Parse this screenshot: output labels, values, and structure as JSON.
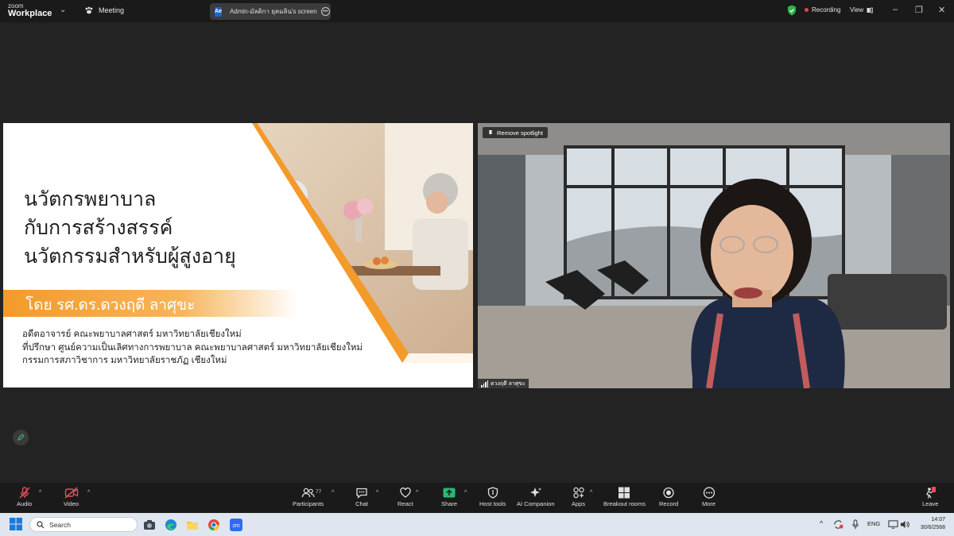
{
  "app": {
    "logo_top": "zoom",
    "logo_bottom": "Workplace",
    "meeting_label": "Meeting"
  },
  "tab": {
    "badge": "Ae",
    "title": "Admin-มัลติกา ยุคมลิน's screen"
  },
  "status": {
    "recording": "Recording",
    "view": "View"
  },
  "slide": {
    "title_lines": [
      "นวัตกรพยาบาล",
      "กับการสร้างสรรค์",
      "นวัตกรรมสำหรับผู้สูงอายุ"
    ],
    "byline": "โดย รศ.ดร.ดวงฤดี ลาศุขะ",
    "sub_lines": [
      "อดีตอาจารย์ คณะพยาบาลศาสตร์ มหาวิทยาลัยเชียงใหม่",
      "ที่ปรึกษา ศูนย์ความเป็นเลิศทางการพยาบาล คณะพยาบาลศาสตร์ มหาวิทยาลัยเชียงใหม่",
      "กรรมการสภาวิชาการ มหาวิทยาลัยราชภัฏ เชียงใหม่"
    ]
  },
  "video": {
    "spotlight_label": "Remove spotlight",
    "participant_name": "ดวงฤดี ลาศุขะ"
  },
  "toolbar": {
    "audio": "Audio",
    "video": "Video",
    "participants": "Participants",
    "participant_count": "77",
    "chat": "Chat",
    "react": "React",
    "share": "Share",
    "host_tools": "Host tools",
    "ai_companion": "AI Companion",
    "apps": "Apps",
    "breakout": "Breakout rooms",
    "record": "Record",
    "more": "More",
    "leave": "Leave"
  },
  "taskbar": {
    "search_placeholder": "Search",
    "lang": "ENG",
    "time": "14:07",
    "date": "30/6/2568"
  },
  "colors": {
    "accent_orange": "#f39a2a",
    "share_green": "#2bb673",
    "rec_red": "#e0453a"
  }
}
